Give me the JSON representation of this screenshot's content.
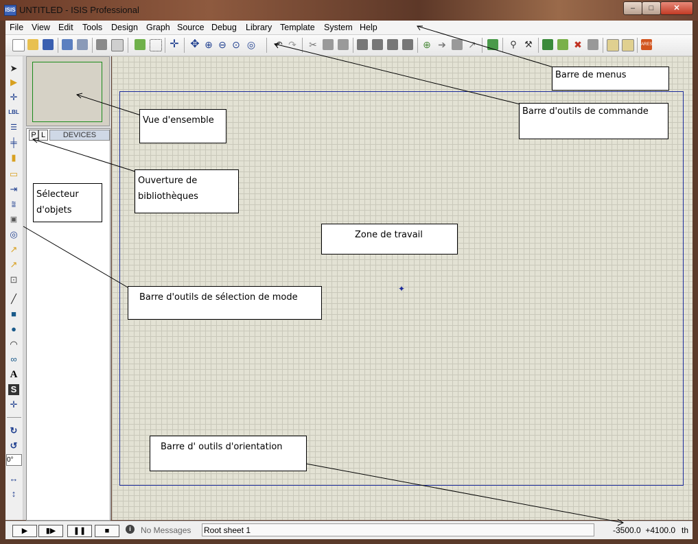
{
  "window": {
    "title": "UNTITLED - ISIS Professional",
    "app_icon_text": "ISIS",
    "min": "–",
    "max": "□",
    "close": "✕"
  },
  "menubar": [
    "File",
    "Edit",
    "View",
    "Tools",
    "Design",
    "Graph",
    "Source",
    "Debug",
    "Library",
    "Template",
    "System",
    "Help"
  ],
  "leftpanel": {
    "pick_button": "P",
    "library_button": "L",
    "devices_header": "DEVICES",
    "rotation_value": "0°"
  },
  "statusbar": {
    "messages": "No Messages",
    "sheet": "Root sheet 1",
    "x_coord": "-3500.0",
    "y_coord": "+4100.0",
    "units": "th"
  },
  "annotations": {
    "menus": "Barre de menus",
    "command_toolbar": "Barre d'outils de commande",
    "overview": "Vue d'ensemble",
    "library_open_1": "Ouverture de",
    "library_open_2": "bibliothèques",
    "object_selector_1": "Sélecteur",
    "object_selector_2": "d'objets",
    "work_area": "Zone de travail",
    "mode_toolbar": "Barre d'outils de sélection de mode",
    "orientation_toolbar": "Barre d' outils d'orientation"
  },
  "colors": {
    "sheet_border": "#1a2a9a",
    "grid_bg": "#e3e2d4",
    "overview_frame": "#1a8a1a"
  }
}
